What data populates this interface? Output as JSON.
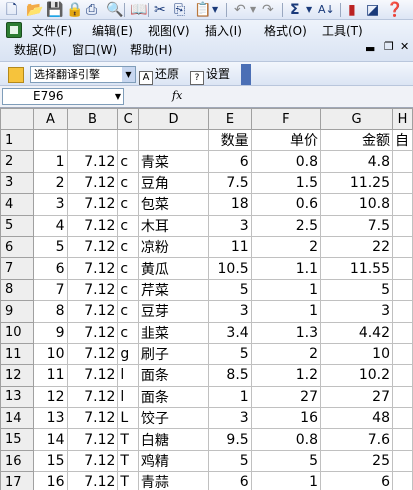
{
  "menu": {
    "file": "文件(F)",
    "edit": "编辑(E)",
    "view": "视图(V)",
    "insert": "插入(I)",
    "format": "格式(O)",
    "tools": "工具(T)",
    "data": "数据(D)",
    "window": "窗口(W)",
    "help": "帮助(H)"
  },
  "translate_bar": {
    "engine_value": "选择翻译引擎",
    "restore_label": "还原",
    "settings_label": "设置"
  },
  "formula_bar": {
    "name_box": "E796",
    "fx": "fx"
  },
  "columns": [
    "A",
    "B",
    "C",
    "D",
    "E",
    "F",
    "G",
    "H"
  ],
  "header_row": {
    "row": "1",
    "A": "",
    "B": "",
    "C": "",
    "D": "",
    "E": "数量",
    "F": "单价",
    "G": "金额",
    "H": "自"
  },
  "rows": [
    {
      "row": "2",
      "A": "1",
      "B": "7.12",
      "C": "c",
      "D": "青菜",
      "E": "6",
      "F": "0.8",
      "G": "4.8"
    },
    {
      "row": "3",
      "A": "2",
      "B": "7.12",
      "C": "c",
      "D": "豆角",
      "E": "7.5",
      "F": "1.5",
      "G": "11.25"
    },
    {
      "row": "4",
      "A": "3",
      "B": "7.12",
      "C": "c",
      "D": "包菜",
      "E": "18",
      "F": "0.6",
      "G": "10.8"
    },
    {
      "row": "5",
      "A": "4",
      "B": "7.12",
      "C": "c",
      "D": "木耳",
      "E": "3",
      "F": "2.5",
      "G": "7.5"
    },
    {
      "row": "6",
      "A": "5",
      "B": "7.12",
      "C": "c",
      "D": "凉粉",
      "E": "11",
      "F": "2",
      "G": "22"
    },
    {
      "row": "7",
      "A": "6",
      "B": "7.12",
      "C": "c",
      "D": "黄瓜",
      "E": "10.5",
      "F": "1.1",
      "G": "11.55"
    },
    {
      "row": "8",
      "A": "7",
      "B": "7.12",
      "C": "c",
      "D": "芹菜",
      "E": "5",
      "F": "1",
      "G": "5"
    },
    {
      "row": "9",
      "A": "8",
      "B": "7.12",
      "C": "c",
      "D": "豆芽",
      "E": "3",
      "F": "1",
      "G": "3"
    },
    {
      "row": "10",
      "A": "9",
      "B": "7.12",
      "C": "c",
      "D": "韭菜",
      "E": "3.4",
      "F": "1.3",
      "G": "4.42"
    },
    {
      "row": "11",
      "A": "10",
      "B": "7.12",
      "C": "g",
      "D": "刷子",
      "E": "5",
      "F": "2",
      "G": "10"
    },
    {
      "row": "12",
      "A": "11",
      "B": "7.12",
      "C": "l",
      "D": "面条",
      "E": "8.5",
      "F": "1.2",
      "G": "10.2"
    },
    {
      "row": "13",
      "A": "12",
      "B": "7.12",
      "C": "l",
      "D": "面条",
      "E": "1",
      "F": "27",
      "G": "27"
    },
    {
      "row": "14",
      "A": "13",
      "B": "7.12",
      "C": "L",
      "D": "饺子",
      "E": "3",
      "F": "16",
      "G": "48"
    },
    {
      "row": "15",
      "A": "14",
      "B": "7.12",
      "C": "T",
      "D": "白糖",
      "E": "9.5",
      "F": "0.8",
      "G": "7.6"
    },
    {
      "row": "16",
      "A": "15",
      "B": "7.12",
      "C": "T",
      "D": "鸡精",
      "E": "5",
      "F": "5",
      "G": "25"
    },
    {
      "row": "17",
      "A": "16",
      "B": "7.12",
      "C": "T",
      "D": "青蒜",
      "E": "6",
      "F": "1",
      "G": "6"
    }
  ]
}
